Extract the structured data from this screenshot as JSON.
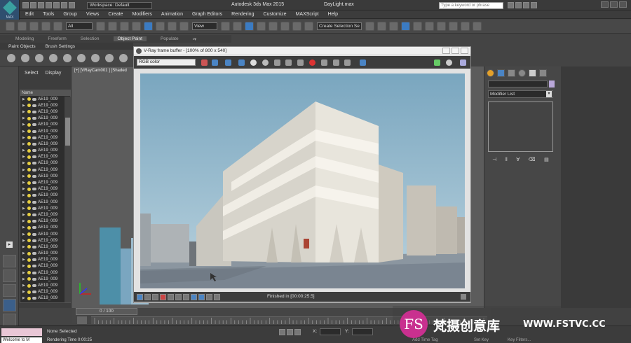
{
  "titlebar": {
    "workspace": "Workspace: Default",
    "app_title": "Autodesk 3ds Max 2015",
    "file_name": "DayLight.max",
    "search_placeholder": "Type a keyword or phrase",
    "logo_text": "MAX"
  },
  "menu": [
    "Edit",
    "Tools",
    "Group",
    "Views",
    "Create",
    "Modifiers",
    "Animation",
    "Graph Editors",
    "Rendering",
    "Customize",
    "MAXScript",
    "Help"
  ],
  "toolbar": {
    "filter_value": "All",
    "refcoord_value": "View",
    "selection_set_value": "Create Selection Se"
  },
  "ribbon": {
    "tabs": [
      "Modeling",
      "Freeform",
      "Selection",
      "Object Paint",
      "Populate"
    ],
    "active_tab": "Object Paint",
    "subtabs": [
      "Paint Objects",
      "Brush Settings"
    ]
  },
  "scene_explorer": {
    "tabs": [
      "Select",
      "Display"
    ],
    "column_header": "Name",
    "rows": [
      "AE19_009",
      "AE19_009",
      "AE19_009",
      "AE19_009",
      "AE19_009",
      "AE19_009",
      "AE19_009",
      "AE19_009",
      "AE19_009",
      "AE19_009",
      "AE19_009",
      "AE19_009",
      "AE19_009",
      "AE19_009",
      "AE19_009",
      "AE19_009",
      "AE19_009",
      "AE19_009",
      "AE19_009",
      "AE19_009",
      "AE19_009",
      "AE19_009",
      "AE19_009",
      "AE19_009",
      "AE19_009",
      "AE19_009",
      "AE19_009",
      "AE19_009",
      "AE19_009",
      "AE19_009",
      "AE19_009",
      "AE19_009"
    ]
  },
  "viewport": {
    "label": "[+] [VRayCam001 ] [Shaded"
  },
  "vray": {
    "title": "V-Ray frame buffer - [100% of 800 x 540]",
    "channel": "RGB color",
    "status": "Finished in [00:00:25.5]"
  },
  "command_panel": {
    "modifier_list": "Modifier List"
  },
  "timeline": {
    "slider": "0 / 100"
  },
  "status_bar": {
    "selection": "None Selected",
    "render_time": "Rendering Time  0:00:25",
    "welcome": "Welcome to M",
    "x_label": "X:",
    "y_label": "Y:",
    "add_time_tag": "Add Time Tag",
    "set_key": "Set Key",
    "key_filters": "Key Filters..."
  },
  "watermark": {
    "logo": "FS",
    "cn": "梵摄创意库",
    "en": "WWW.FSTVC.CC"
  },
  "colors": {
    "accent_blue": "#3b7bc2",
    "sky": "#8ab4cc",
    "watermark_pink": "#c9308f"
  }
}
